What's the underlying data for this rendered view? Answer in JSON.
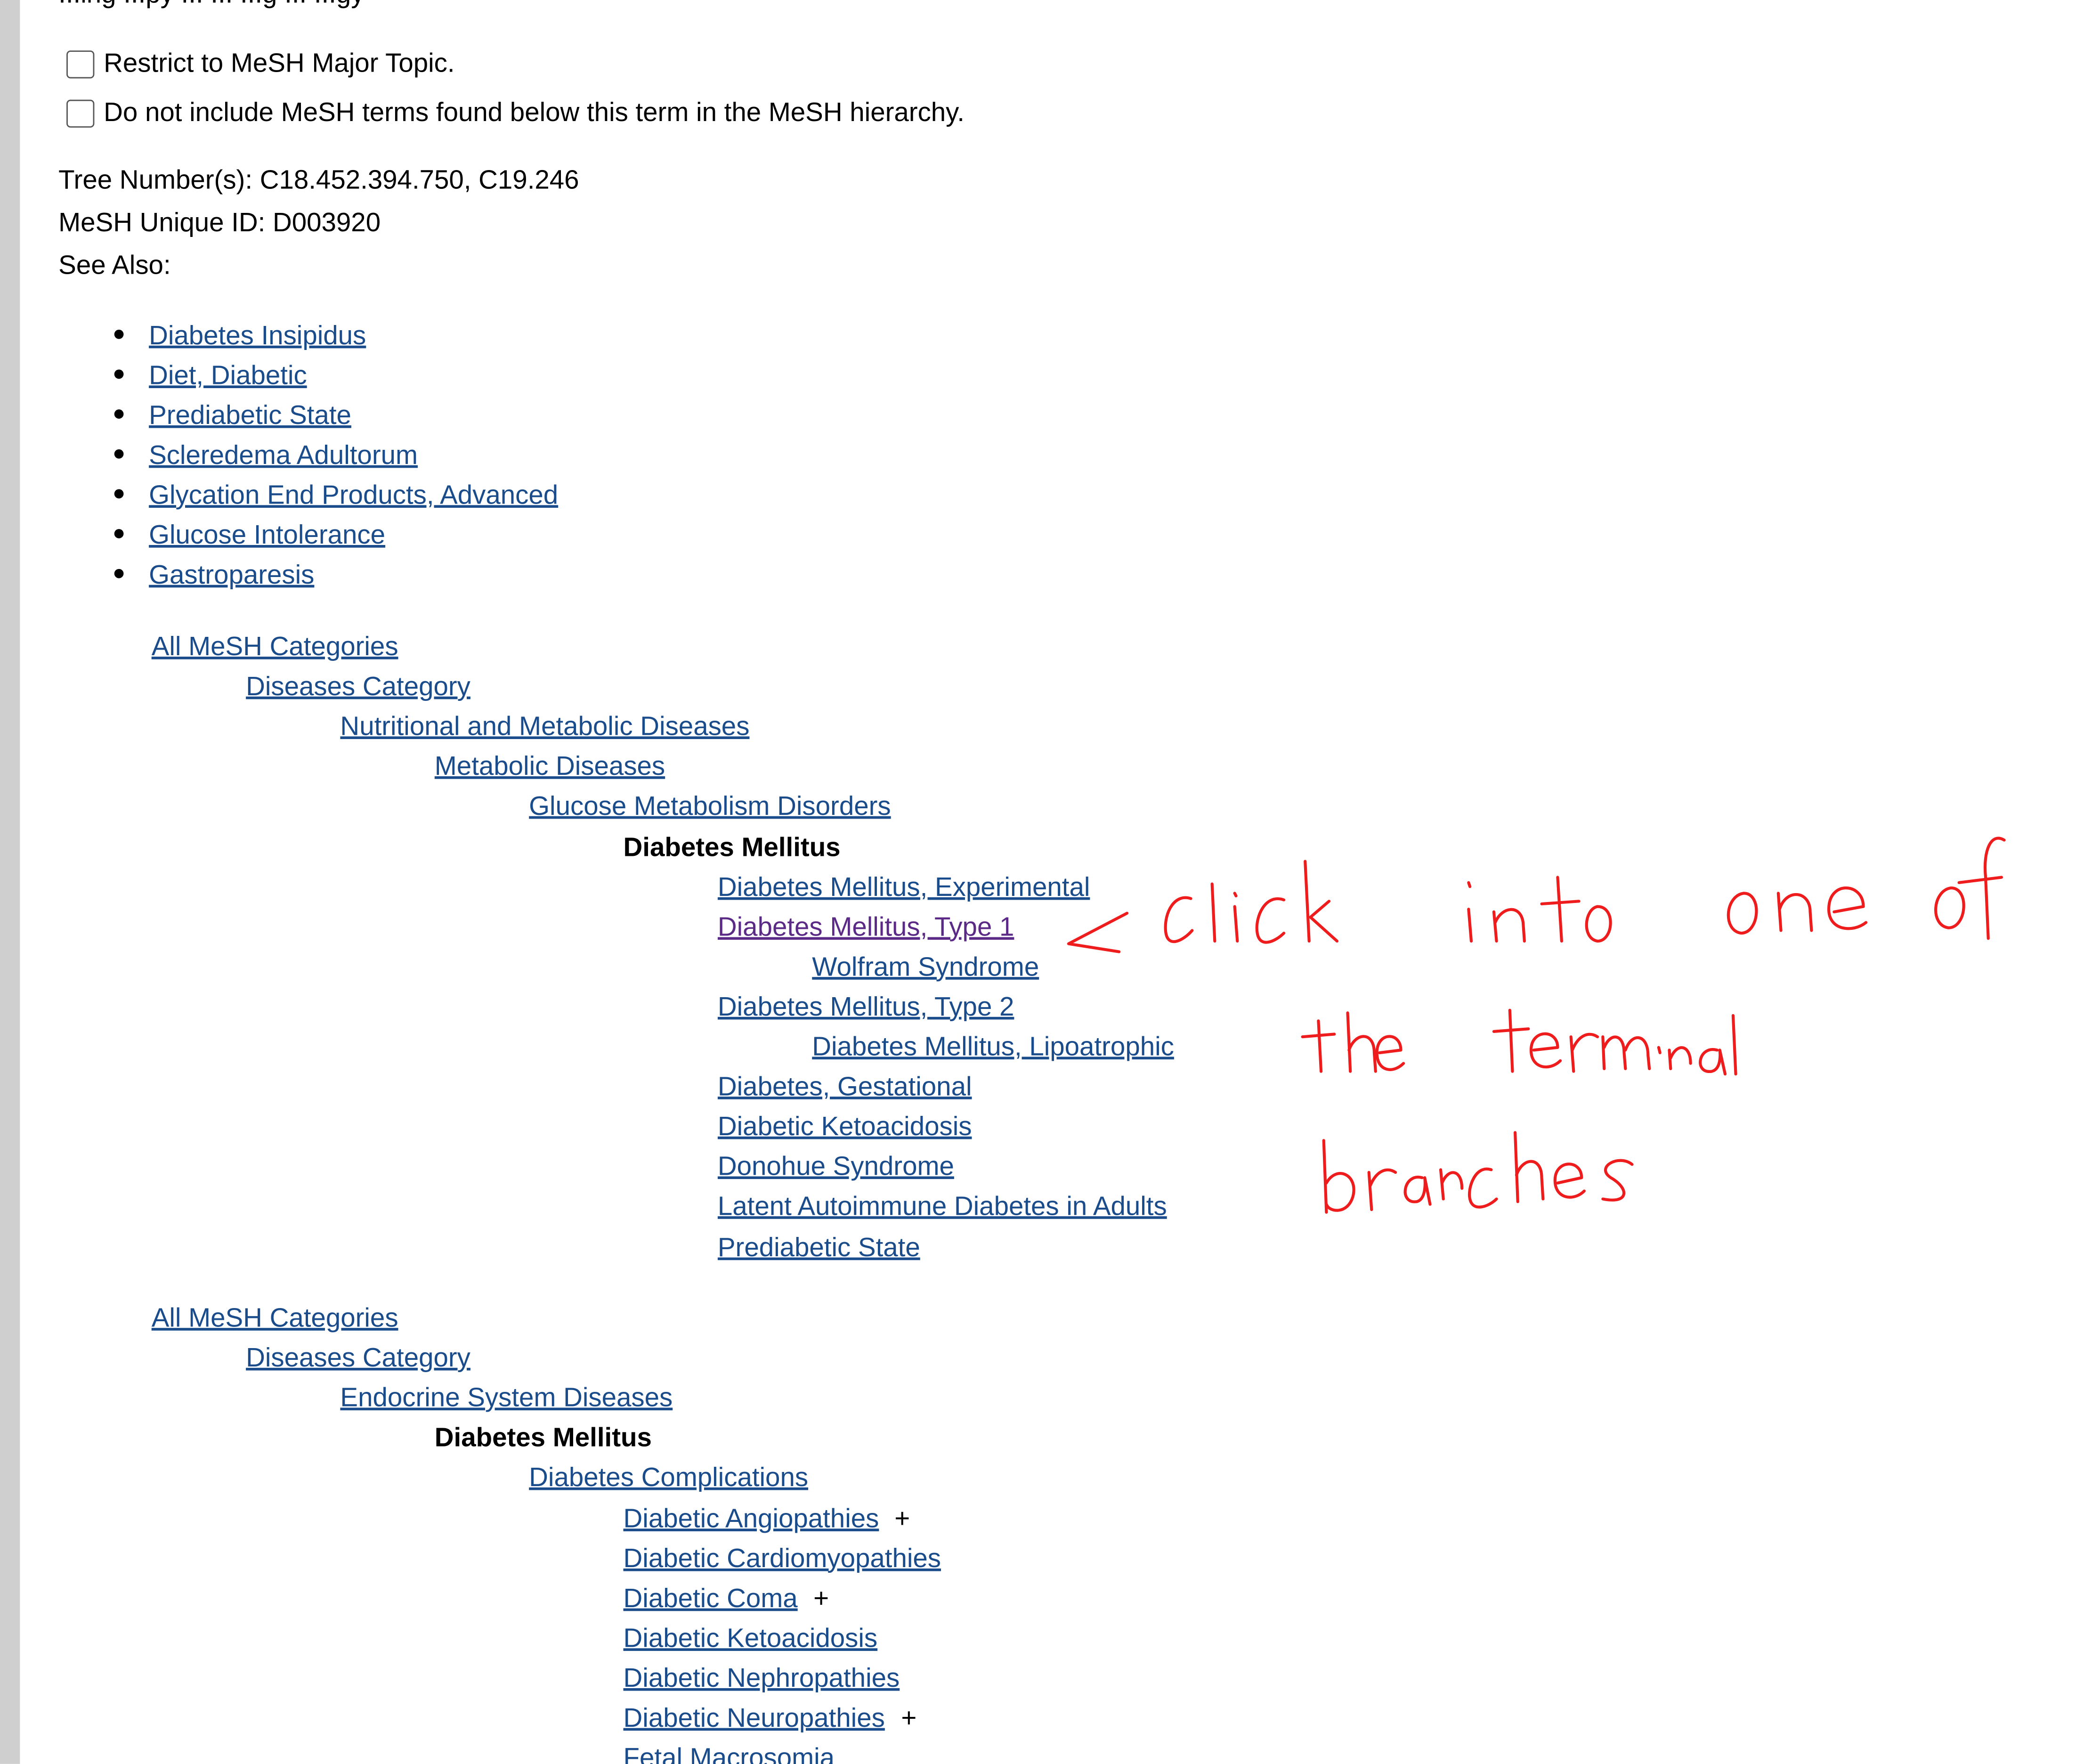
{
  "cutoff_text": "...ing ...py ... ... ...g ... ...gy",
  "options": {
    "restrict_major": "Restrict to MeSH Major Topic.",
    "no_explode": "Do not include MeSH terms found below this term in the MeSH hierarchy."
  },
  "meta": {
    "tree_numbers": "Tree Number(s): C18.452.394.750, C19.246",
    "unique_id": "MeSH Unique ID: D003920",
    "see_also_label": "See Also:"
  },
  "see_also": [
    "Diabetes Insipidus",
    "Diet, Diabetic",
    "Prediabetic State",
    "Scleredema Adultorum",
    "Glycation End Products, Advanced",
    "Glucose Intolerance",
    "Gastroparesis"
  ],
  "tree1": [
    {
      "label": "All MeSH Categories",
      "level": 0,
      "type": "link"
    },
    {
      "label": "Diseases Category",
      "level": 1,
      "type": "link"
    },
    {
      "label": "Nutritional and Metabolic Diseases",
      "level": 2,
      "type": "link"
    },
    {
      "label": "Metabolic Diseases",
      "level": 3,
      "type": "link"
    },
    {
      "label": "Glucose Metabolism Disorders",
      "level": 4,
      "type": "link"
    },
    {
      "label": "Diabetes Mellitus",
      "level": 5,
      "type": "current"
    },
    {
      "label": "Diabetes Mellitus, Experimental",
      "level": 6,
      "type": "link"
    },
    {
      "label": "Diabetes Mellitus, Type 1",
      "level": 6,
      "type": "visited"
    },
    {
      "label": "Wolfram Syndrome",
      "level": 7,
      "type": "link"
    },
    {
      "label": "Diabetes Mellitus, Type 2",
      "level": 6,
      "type": "link"
    },
    {
      "label": "Diabetes Mellitus, Lipoatrophic",
      "level": 7,
      "type": "link"
    },
    {
      "label": "Diabetes, Gestational",
      "level": 6,
      "type": "link"
    },
    {
      "label": "Diabetic Ketoacidosis",
      "level": 6,
      "type": "link"
    },
    {
      "label": "Donohue Syndrome",
      "level": 6,
      "type": "link"
    },
    {
      "label": "Latent Autoimmune Diabetes in Adults",
      "level": 6,
      "type": "link"
    },
    {
      "label": "Prediabetic State",
      "level": 6,
      "type": "link"
    }
  ],
  "tree2": [
    {
      "label": "All MeSH Categories",
      "level": 0,
      "type": "link"
    },
    {
      "label": "Diseases Category",
      "level": 1,
      "type": "link"
    },
    {
      "label": "Endocrine System Diseases",
      "level": 2,
      "type": "link"
    },
    {
      "label": "Diabetes Mellitus",
      "level": 3,
      "type": "current"
    },
    {
      "label": "Diabetes Complications",
      "level": 4,
      "type": "link"
    },
    {
      "label": "Diabetic Angiopathies",
      "level": 5,
      "type": "link",
      "plus": "+"
    },
    {
      "label": "Diabetic Cardiomyopathies",
      "level": 5,
      "type": "link"
    },
    {
      "label": "Diabetic Coma",
      "level": 5,
      "type": "link",
      "plus": "+"
    },
    {
      "label": "Diabetic Ketoacidosis",
      "level": 5,
      "type": "link"
    },
    {
      "label": "Diabetic Nephropathies",
      "level": 5,
      "type": "link"
    },
    {
      "label": "Diabetic Neuropathies",
      "level": 5,
      "type": "link",
      "plus": "+"
    },
    {
      "label": "Fetal Macrosomia",
      "level": 5,
      "type": "link"
    }
  ],
  "annotation": {
    "text": "click into one of the terminal branches",
    "color": "#ee1c1c"
  },
  "colors": {
    "link": "#1a4c8b",
    "visited": "#5b2a86",
    "rail": "#cfcfcf"
  }
}
